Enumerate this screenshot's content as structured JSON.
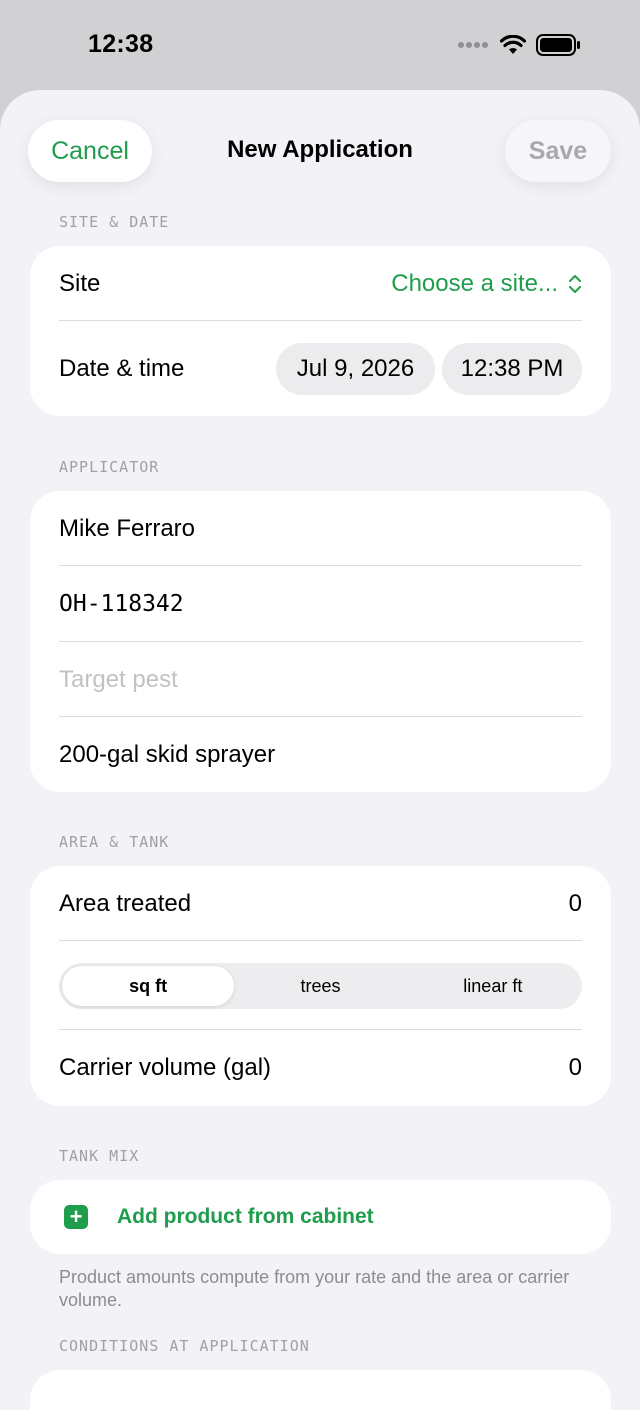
{
  "status_bar": {
    "time": "12:38"
  },
  "nav": {
    "cancel": "Cancel",
    "title": "New Application",
    "save": "Save"
  },
  "site_date": {
    "header": "SITE & DATE",
    "site_label": "Site",
    "site_value": "Choose a site...",
    "date_label": "Date & time",
    "date_value": "Jul 9, 2026",
    "time_value": "12:38 PM"
  },
  "applicator": {
    "header": "APPLICATOR",
    "name": "Mike Ferraro",
    "license": "OH-118342",
    "target_pest_placeholder": "Target pest",
    "equipment": "200-gal skid sprayer"
  },
  "area_tank": {
    "header": "AREA & TANK",
    "area_label": "Area treated",
    "area_value": "0",
    "units": [
      "sq ft",
      "trees",
      "linear ft"
    ],
    "carrier_label": "Carrier volume (gal)",
    "carrier_value": "0"
  },
  "tank_mix": {
    "header": "TANK MIX",
    "add_label": "Add product from cabinet",
    "footnote": "Product amounts compute from your rate and the area or carrier volume."
  },
  "conditions": {
    "header": "CONDITIONS AT APPLICATION"
  },
  "colors": {
    "accent": "#1f9d4c",
    "background": "#f2f2f7"
  }
}
